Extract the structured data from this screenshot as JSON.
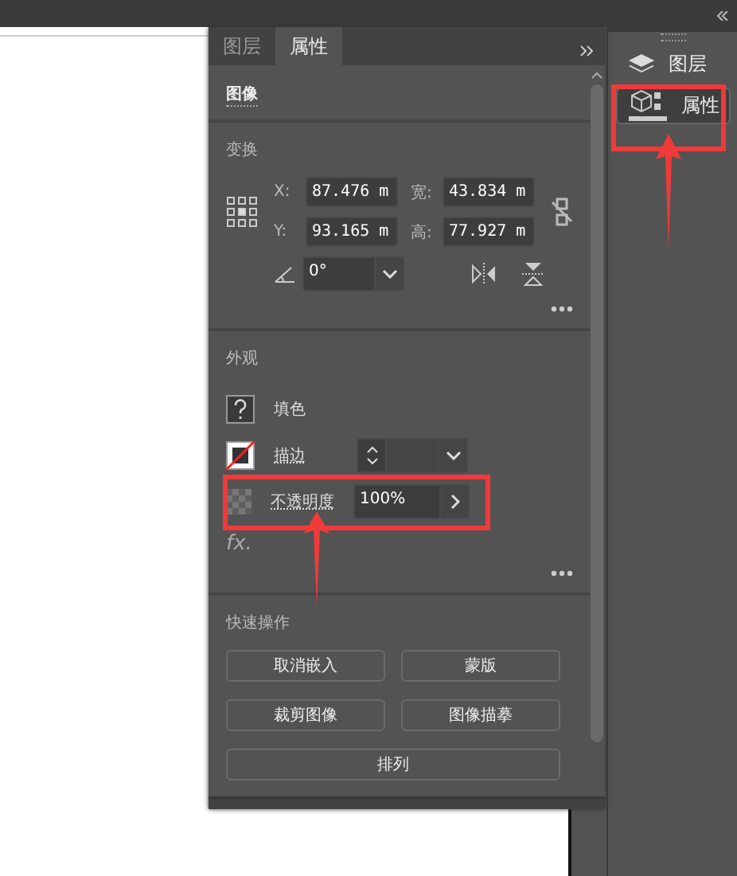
{
  "panel": {
    "tabs": [
      {
        "label": "图层",
        "selected": false
      },
      {
        "label": "属性",
        "selected": true
      }
    ],
    "object_type": "图像",
    "transform": {
      "title": "变换",
      "fields": [
        {
          "label": "X:",
          "value": "87.476 m"
        },
        {
          "label": "宽:",
          "value": "43.834 m"
        },
        {
          "label": "Y:",
          "value": "93.165 m"
        },
        {
          "label": "高:",
          "value": "77.927 m"
        }
      ],
      "angle": "0°"
    },
    "appearance": {
      "title": "外观",
      "fill_label": "填色",
      "stroke_label": "描边",
      "opacity_label": "不透明度",
      "opacity": "100%",
      "effects_label": "fx."
    },
    "quick_actions": {
      "title": "快速操作",
      "buttons": [
        "取消嵌入",
        "蒙版",
        "裁剪图像",
        "图像描摹"
      ],
      "wide_button": "排列"
    }
  },
  "dock": {
    "items": [
      {
        "label": "图层",
        "selected": false
      },
      {
        "label": "属性",
        "selected": true
      }
    ]
  }
}
